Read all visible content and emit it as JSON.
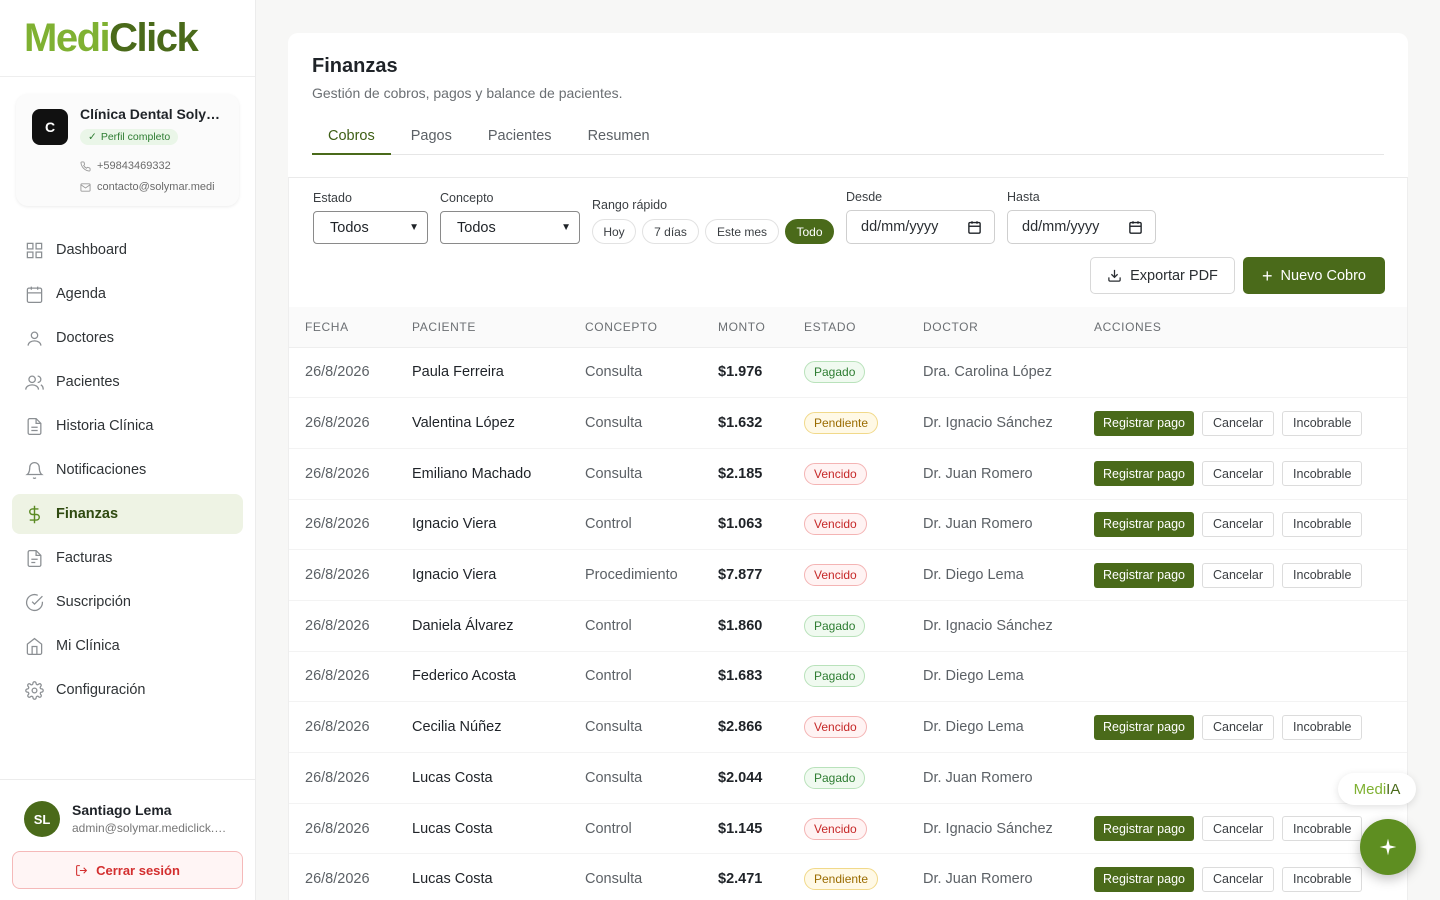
{
  "brand": {
    "medi": "Medi",
    "click": "Click",
    "medi_color": "#7fb132",
    "click_color": "#4a6a1a"
  },
  "clinic": {
    "initial": "C",
    "name": "Clínica Dental Solymar",
    "badge": "Perfil completo",
    "phone": "+59843469332",
    "email": "contacto@solymar.medi"
  },
  "sidebar": {
    "items": [
      {
        "label": "Dashboard",
        "icon": "grid-icon"
      },
      {
        "label": "Agenda",
        "icon": "calendar-icon"
      },
      {
        "label": "Doctores",
        "icon": "user-icon"
      },
      {
        "label": "Pacientes",
        "icon": "users-icon"
      },
      {
        "label": "Historia Clínica",
        "icon": "file-icon"
      },
      {
        "label": "Notificaciones",
        "icon": "bell-icon"
      },
      {
        "label": "Finanzas",
        "icon": "dollar-icon",
        "active": true
      },
      {
        "label": "Facturas",
        "icon": "receipt-icon"
      },
      {
        "label": "Suscripción",
        "icon": "check-circle-icon"
      },
      {
        "label": "Mi Clínica",
        "icon": "home-icon"
      },
      {
        "label": "Configuración",
        "icon": "gear-icon"
      }
    ]
  },
  "user": {
    "initials": "SL",
    "name": "Santiago Lema",
    "email": "admin@solymar.mediclick.com",
    "logout_label": "Cerrar sesión"
  },
  "page": {
    "title": "Finanzas",
    "subtitle": "Gestión de cobros, pagos y balance de pacientes.",
    "tabs": [
      "Cobros",
      "Pagos",
      "Pacientes",
      "Resumen"
    ],
    "active_tab": "Cobros"
  },
  "filters": {
    "estado_label": "Estado",
    "estado_value": "Todos",
    "concepto_label": "Concepto",
    "concepto_value": "Todos",
    "rango_label": "Rango rápido",
    "rango_options": [
      "Hoy",
      "7 días",
      "Este mes",
      "Todo"
    ],
    "rango_active": "Todo",
    "desde_label": "Desde",
    "desde_placeholder": "dd/mm/yyyy",
    "hasta_label": "Hasta",
    "hasta_placeholder": "dd/mm/yyyy"
  },
  "toolbar": {
    "export_label": "Exportar PDF",
    "new_label": "Nuevo Cobro"
  },
  "table": {
    "headers": [
      "FECHA",
      "PACIENTE",
      "CONCEPTO",
      "MONTO",
      "ESTADO",
      "DOCTOR",
      "ACCIONES"
    ],
    "action_labels": {
      "register": "Registrar pago",
      "cancel": "Cancelar",
      "bad_debt": "Incobrable"
    },
    "rows": [
      {
        "date": "26/8/2026",
        "patient": "Paula Ferreira",
        "concept": "Consulta",
        "amount": "$1.976",
        "status": "Pagado",
        "doctor": "Dra. Carolina López"
      },
      {
        "date": "26/8/2026",
        "patient": "Valentina López",
        "concept": "Consulta",
        "amount": "$1.632",
        "status": "Pendiente",
        "doctor": "Dr. Ignacio Sánchez"
      },
      {
        "date": "26/8/2026",
        "patient": "Emiliano Machado",
        "concept": "Consulta",
        "amount": "$2.185",
        "status": "Vencido",
        "doctor": "Dr. Juan Romero"
      },
      {
        "date": "26/8/2026",
        "patient": "Ignacio Viera",
        "concept": "Control",
        "amount": "$1.063",
        "status": "Vencido",
        "doctor": "Dr. Juan Romero"
      },
      {
        "date": "26/8/2026",
        "patient": "Ignacio Viera",
        "concept": "Procedimiento",
        "amount": "$7.877",
        "status": "Vencido",
        "doctor": "Dr. Diego Lema"
      },
      {
        "date": "26/8/2026",
        "patient": "Daniela Álvarez",
        "concept": "Control",
        "amount": "$1.860",
        "status": "Pagado",
        "doctor": "Dr. Ignacio Sánchez"
      },
      {
        "date": "26/8/2026",
        "patient": "Federico Acosta",
        "concept": "Control",
        "amount": "$1.683",
        "status": "Pagado",
        "doctor": "Dr. Diego Lema"
      },
      {
        "date": "26/8/2026",
        "patient": "Cecilia Núñez",
        "concept": "Consulta",
        "amount": "$2.866",
        "status": "Vencido",
        "doctor": "Dr. Diego Lema"
      },
      {
        "date": "26/8/2026",
        "patient": "Lucas Costa",
        "concept": "Consulta",
        "amount": "$2.044",
        "status": "Pagado",
        "doctor": "Dr. Juan Romero"
      },
      {
        "date": "26/8/2026",
        "patient": "Lucas Costa",
        "concept": "Control",
        "amount": "$1.145",
        "status": "Vencido",
        "doctor": "Dr. Ignacio Sánchez"
      },
      {
        "date": "26/8/2026",
        "patient": "Lucas Costa",
        "concept": "Consulta",
        "amount": "$2.471",
        "status": "Pendiente",
        "doctor": "Dr. Juan Romero"
      }
    ]
  },
  "assistant": {
    "label_a": "Medi",
    "label_b": "IA",
    "fab_icon": "sparkle-icon"
  },
  "colors": {
    "accent": "#4a6a1a",
    "paid": "#2e7d32",
    "pending": "#9a6b00",
    "overdue": "#c62828"
  }
}
